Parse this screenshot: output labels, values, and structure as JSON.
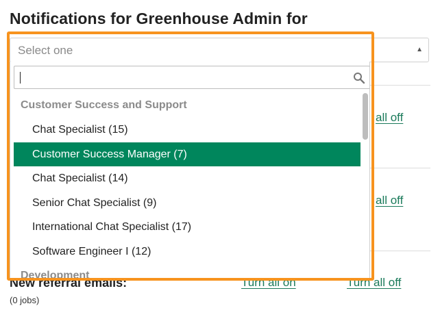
{
  "page": {
    "title": "Notifications for Greenhouse Admin for"
  },
  "select": {
    "value": "Select one",
    "arrow_icon": "triangle-up-icon"
  },
  "search": {
    "value": "",
    "icon": "magnifier-icon"
  },
  "dropdown": {
    "groups": [
      {
        "label": "Customer Success and Support",
        "options": [
          {
            "label": "Chat Specialist (15)",
            "selected": false
          },
          {
            "label": "Customer Success Manager (7)",
            "selected": true
          },
          {
            "label": "Chat Specialist (14)",
            "selected": false
          },
          {
            "label": "Senior Chat Specialist (9)",
            "selected": false
          },
          {
            "label": "International Chat Specialist (17)",
            "selected": false
          },
          {
            "label": "Software Engineer I (12)",
            "selected": false
          }
        ]
      },
      {
        "label": "Development",
        "options": []
      }
    ]
  },
  "background_rows": {
    "row1_link": "all off",
    "row2_link": "all off",
    "referral": {
      "title": "New referral emails:",
      "subtitle": "(0 jobs)",
      "link_left": "Turn all on",
      "link_right": "Turn all off"
    }
  },
  "colors": {
    "selected_bg": "#00865c",
    "link": "#1a7a5a",
    "highlight": "#f7931e"
  }
}
